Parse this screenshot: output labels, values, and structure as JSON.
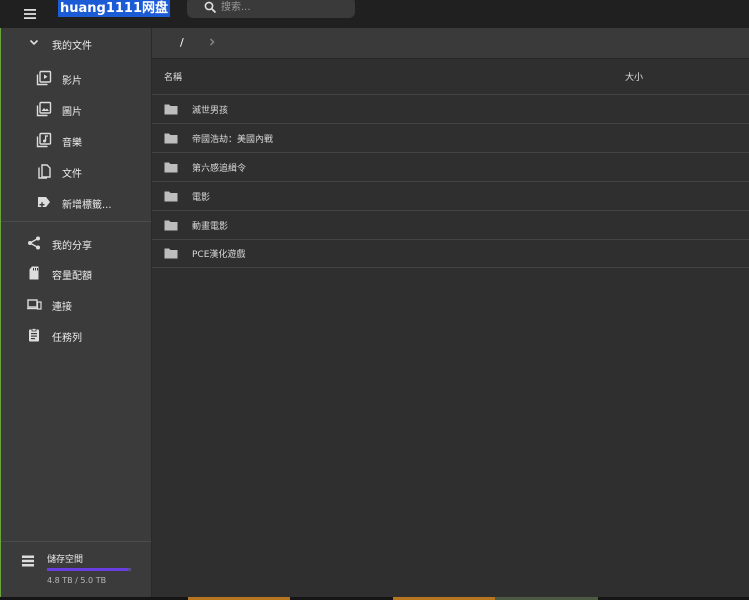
{
  "header": {
    "brand": "huang1111网盘",
    "search_placeholder": "搜索..."
  },
  "sidebar": {
    "my_files": "我的文件",
    "sub_items": [
      {
        "label": "影片",
        "icon": "video-library-icon"
      },
      {
        "label": "圖片",
        "icon": "photo-library-icon"
      },
      {
        "label": "音樂",
        "icon": "music-library-icon"
      },
      {
        "label": "文件",
        "icon": "documents-icon"
      },
      {
        "label": "新增標籤...",
        "icon": "add-tag-icon"
      }
    ],
    "main_items": [
      {
        "label": "我的分享",
        "icon": "share-icon"
      },
      {
        "label": "容量配額",
        "icon": "sd-card-icon"
      },
      {
        "label": "連接",
        "icon": "devices-icon"
      },
      {
        "label": "任務列",
        "icon": "clipboard-icon"
      }
    ],
    "storage": {
      "title": "儲存空間",
      "usage": "4.8 TB / 5.0 TB",
      "used_fraction": 0.96,
      "bar_color": "#6a3fe0"
    }
  },
  "breadcrumb": {
    "root": "/"
  },
  "list": {
    "col_name": "名稱",
    "col_size": "大小",
    "rows": [
      {
        "name": "滅世男孩"
      },
      {
        "name": "帝國浩劫：美國內戰"
      },
      {
        "name": "第六感追緝令"
      },
      {
        "name": "電影"
      },
      {
        "name": "動畫電影"
      },
      {
        "name": "PCE漢化遊戲"
      }
    ]
  },
  "colors": {
    "appbar": "#202020",
    "sidebar": "#3b3b3b",
    "content": "#2f2f2f",
    "brand_highlight": "#1c5bd6"
  }
}
